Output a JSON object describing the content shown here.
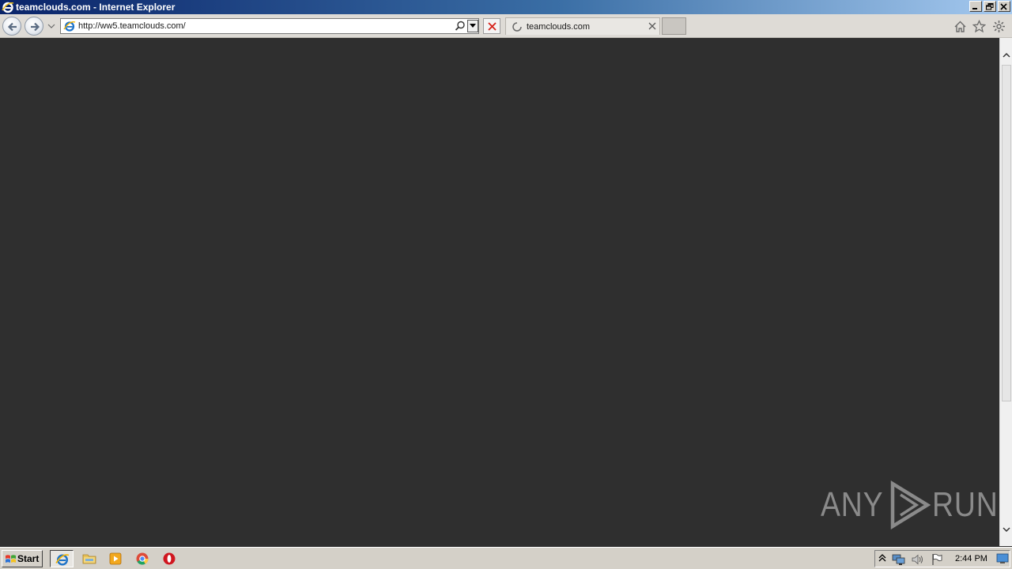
{
  "window": {
    "title": "teamclouds.com - Internet Explorer"
  },
  "address_bar": {
    "url": "http://ww5.teamclouds.com/"
  },
  "tabs": [
    {
      "label": "teamclouds.com",
      "loading": true
    }
  ],
  "watermark": {
    "left_text": "ANY",
    "right_text": "RUN"
  },
  "taskbar": {
    "start_label": "Start",
    "apps": [
      "internet-explorer",
      "file-explorer",
      "media-player",
      "chrome",
      "opera"
    ],
    "clock": "2:44 PM"
  },
  "colors": {
    "content_bg": "#2f2f2f",
    "title_gradient_start": "#0a246a",
    "taskbar_bg": "#d4d0c8"
  }
}
